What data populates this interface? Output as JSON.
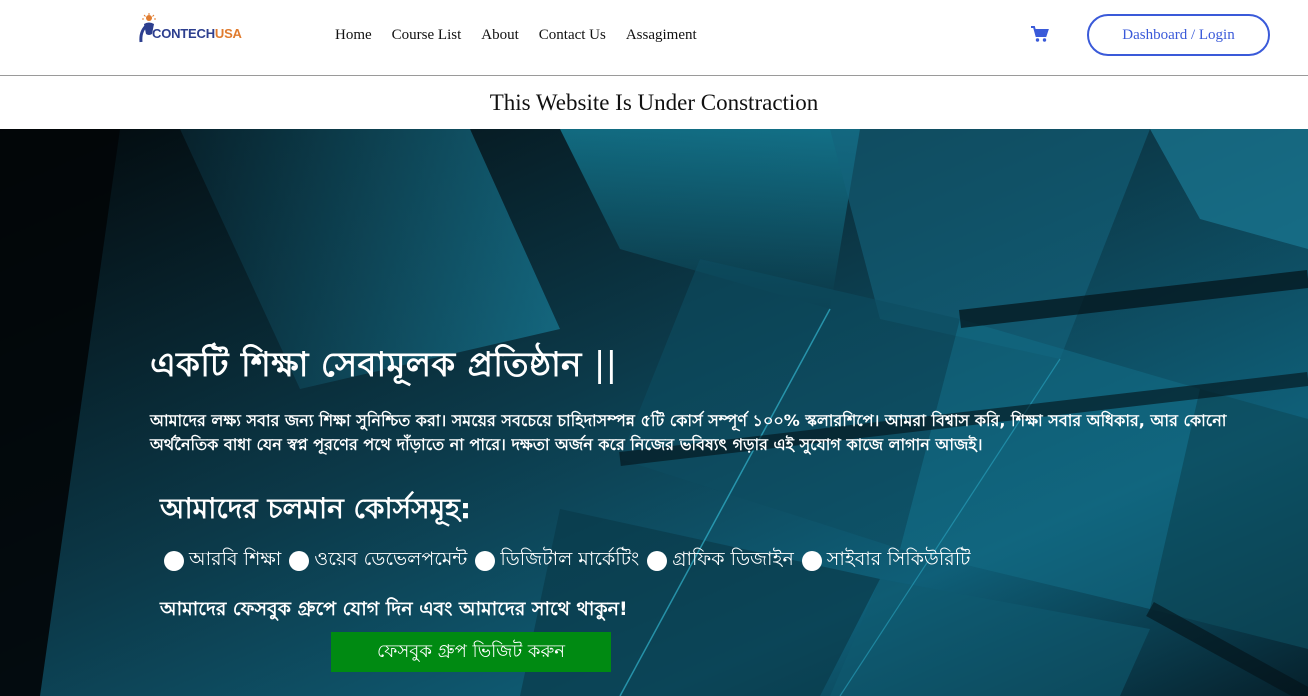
{
  "header": {
    "logo": {
      "part1": "CONTECH",
      "part2": "USA",
      "color_primary": "#2d3f8f",
      "color_accent": "#e07b2e"
    },
    "nav": [
      {
        "label": "Home"
      },
      {
        "label": "Course List"
      },
      {
        "label": "About"
      },
      {
        "label": "Contact Us"
      },
      {
        "label": "Assagiment"
      }
    ],
    "cart_icon": "shopping-cart-icon",
    "login_label": "Dashboard / Login",
    "accent": "#3a5ad9"
  },
  "notice": {
    "text": "This Website Is Under Constraction"
  },
  "hero": {
    "title": "একটি শিক্ষা সেবামূলক প্রতিষ্ঠান",
    "title_suffix": "||",
    "description": "আমাদের লক্ষ্য সবার জন্য শিক্ষা সুনিশ্চিত করা। সময়ের সবচেয়ে চাহিদাসম্পন্ন ৫টি কোর্স সম্পূর্ণ ১০০% স্কলারশিপে। আমরা বিশ্বাস করি, শিক্ষা সবার অধিকার, আর কোনো অর্থনৈতিক বাধা যেন স্বপ্ন পূরণের পথে দাঁড়াতে না পারে। দক্ষতা অর্জন করে নিজের ভবিষ্যৎ গড়ার এই সুযোগ কাজে লাগান আজই।",
    "courses_title": "আমাদের চলমান কোর্সসমূহ:",
    "courses": [
      {
        "label": "আরবি শিক্ষা"
      },
      {
        "label": "ওয়েব ডেভেলপমেন্ট"
      },
      {
        "label": "ডিজিটাল মার্কেটিং"
      },
      {
        "label": "গ্রাফিক ডিজাইন"
      },
      {
        "label": "সাইবার সিকিউরিটি"
      }
    ],
    "facebook_text": "আমাদের ফেসবুক গ্রুপে যোগ দিন এবং আমাদের সাথে থাকুন!",
    "facebook_button": "ফেসবুক গ্রুপ ভিজিট করুন",
    "button_color": "#008a12"
  }
}
